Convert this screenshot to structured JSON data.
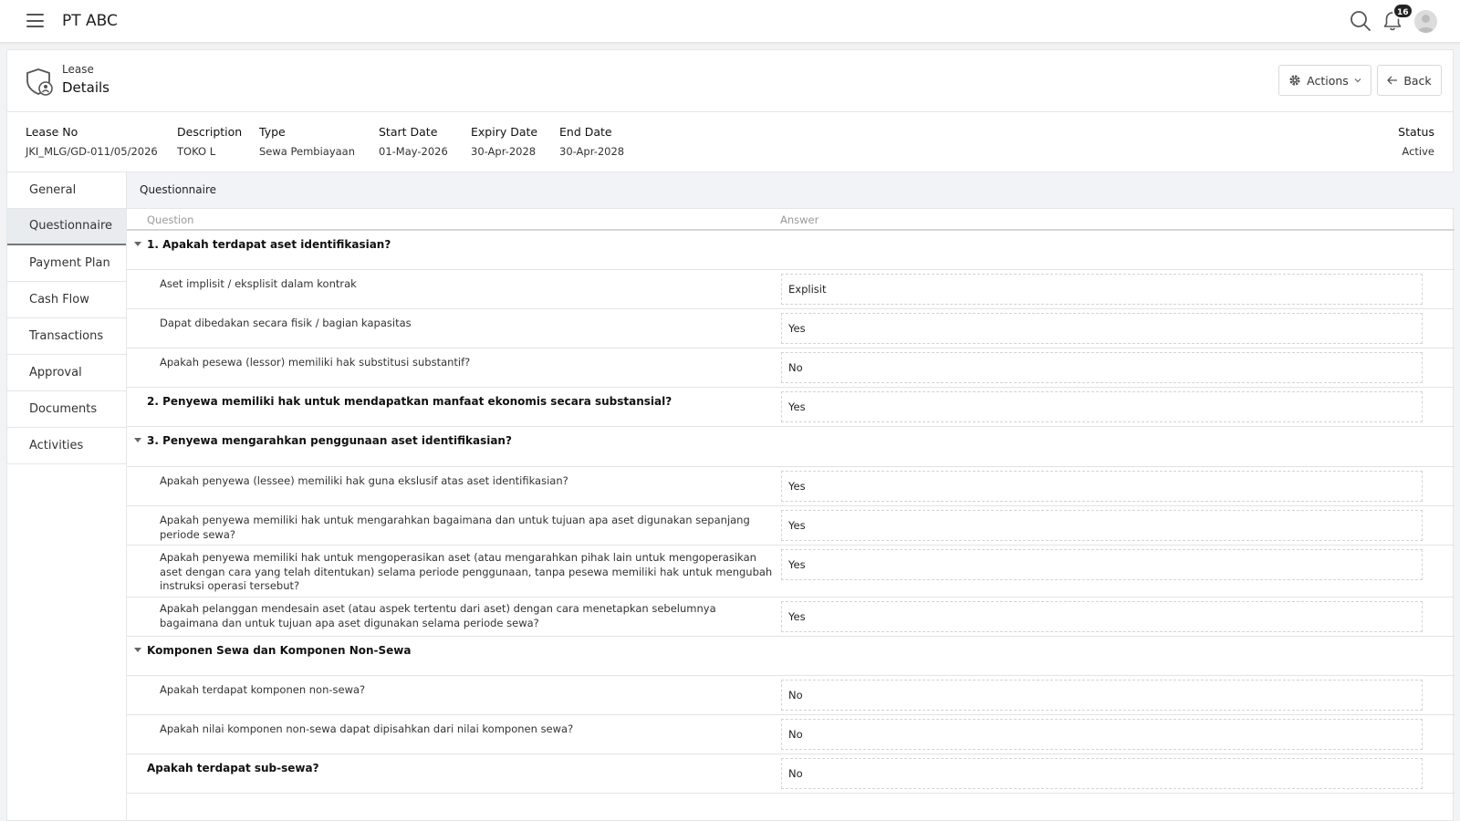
{
  "app": {
    "title": "PT ABC",
    "notification_count": "16"
  },
  "header": {
    "breadcrumb": "Lease",
    "title": "Details",
    "actions_label": "Actions",
    "back_label": "Back"
  },
  "summary": {
    "lease_no": {
      "label": "Lease No",
      "value": "JKI_MLG/GD-011/05/2026"
    },
    "description": {
      "label": "Description",
      "value": "TOKO L"
    },
    "type": {
      "label": "Type",
      "value": "Sewa Pembiayaan"
    },
    "start_date": {
      "label": "Start Date",
      "value": "01-May-2026"
    },
    "expiry_date": {
      "label": "Expiry Date",
      "value": "30-Apr-2028"
    },
    "end_date": {
      "label": "End Date",
      "value": "30-Apr-2028"
    },
    "status": {
      "label": "Status",
      "value": "Active"
    }
  },
  "sidebar": {
    "items": [
      {
        "label": "General"
      },
      {
        "label": "Questionnaire",
        "active": true
      },
      {
        "label": "Payment Plan"
      },
      {
        "label": "Cash Flow"
      },
      {
        "label": "Transactions"
      },
      {
        "label": "Approval"
      },
      {
        "label": "Documents"
      },
      {
        "label": "Activities"
      }
    ]
  },
  "questionnaire": {
    "section_title": "Questionnaire",
    "col_question": "Question",
    "col_answer": "Answer",
    "rows": [
      {
        "question": "1. Apakah terdapat aset identifikasian?",
        "answer": ""
      },
      {
        "question": "Aset implisit / eksplisit dalam kontrak",
        "answer": "Explisit"
      },
      {
        "question": "Dapat dibedakan secara fisik  /  bagian kapasitas",
        "answer": "Yes"
      },
      {
        "question": "Apakah pesewa (lessor) memiliki hak substitusi substantif?",
        "answer": "No"
      },
      {
        "question": "2. Penyewa memiliki hak untuk mendapatkan manfaat ekonomis secara substansial?",
        "answer": "Yes"
      },
      {
        "question": "3. Penyewa mengarahkan penggunaan aset identifikasian?",
        "answer": ""
      },
      {
        "question": "Apakah penyewa (lessee) memiliki hak guna ekslusif atas aset identifikasian?",
        "answer": "Yes"
      },
      {
        "question": "Apakah penyewa memiliki hak untuk mengarahkan bagaimana dan untuk tujuan apa aset digunakan sepanjang periode sewa?",
        "answer": "Yes"
      },
      {
        "question": "Apakah penyewa memiliki hak untuk mengoperasikan aset (atau mengarahkan pihak lain untuk mengoperasikan aset dengan cara yang telah ditentukan) selama periode penggunaan, tanpa pesewa memiliki hak untuk mengubah instruksi operasi tersebut?",
        "answer": "Yes"
      },
      {
        "question": "Apakah pelanggan mendesain aset (atau aspek tertentu dari aset) dengan cara menetapkan sebelumnya bagaimana dan untuk tujuan apa aset digunakan selama periode sewa?",
        "answer": "Yes"
      },
      {
        "question": "Komponen Sewa dan Komponen Non-Sewa",
        "answer": ""
      },
      {
        "question": "Apakah terdapat komponen non-sewa?",
        "answer": "No"
      },
      {
        "question": "Apakah nilai komponen non-sewa dapat dipisahkan dari nilai komponen sewa?",
        "answer": "No"
      },
      {
        "question": "Apakah terdapat sub-sewa?",
        "answer": "No"
      }
    ]
  }
}
